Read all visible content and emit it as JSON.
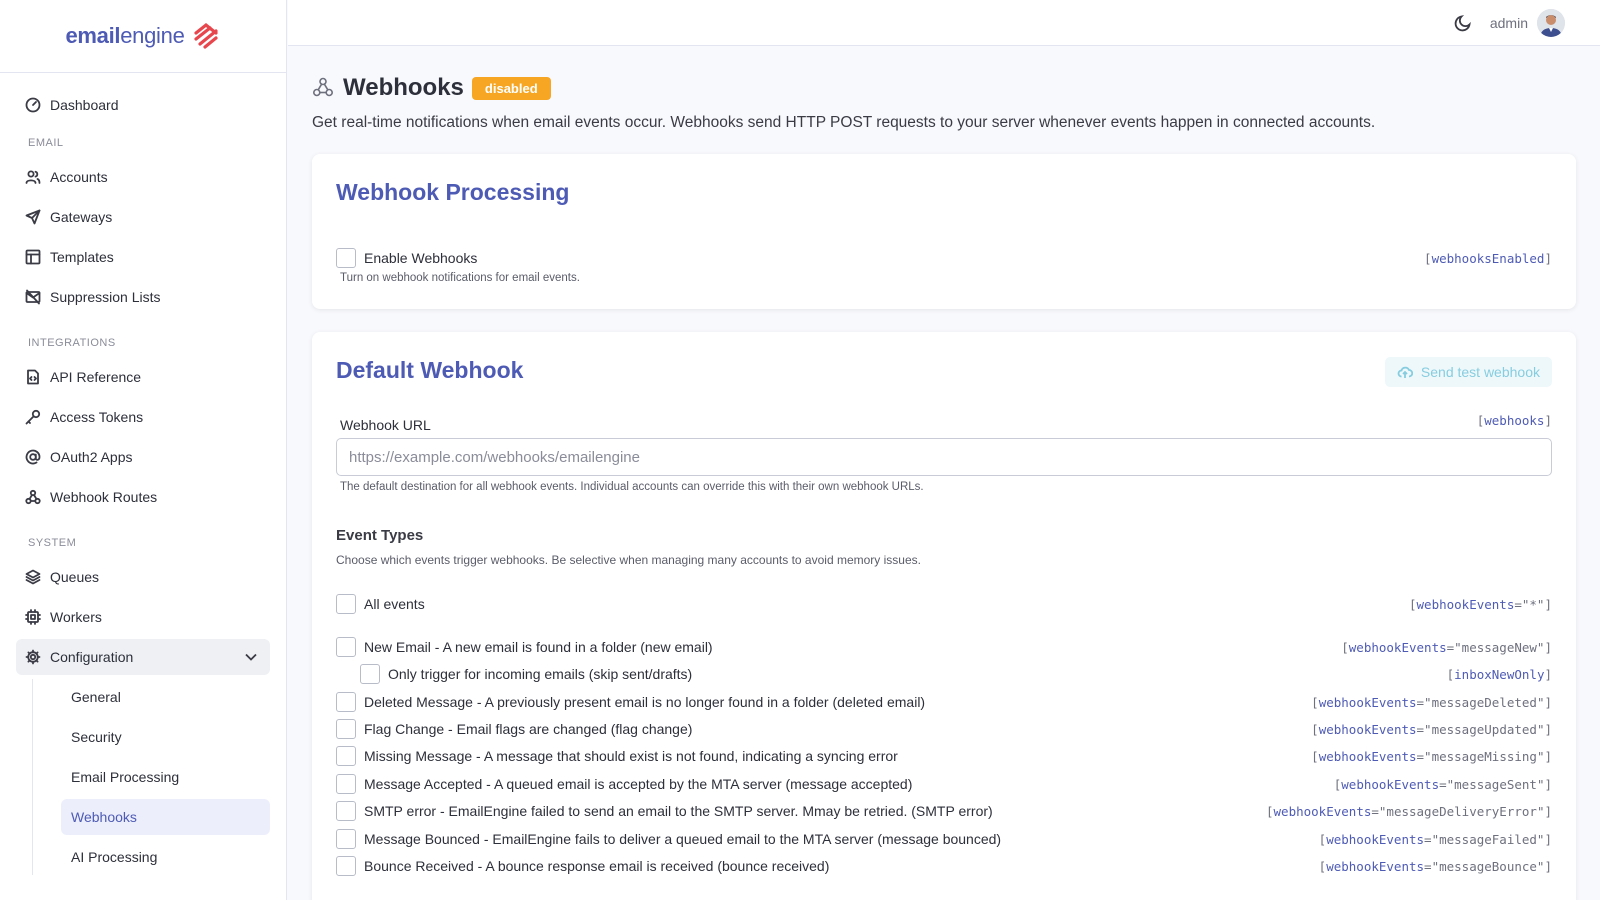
{
  "brand": {
    "name_bold": "email",
    "name_light": "engine",
    "logo_color": "#e8464d"
  },
  "sidebar": {
    "dashboard": "Dashboard",
    "email_heading": "EMAIL",
    "email_items": [
      "Accounts",
      "Gateways",
      "Templates",
      "Suppression Lists"
    ],
    "integrations_heading": "INTEGRATIONS",
    "integrations_items": [
      "API Reference",
      "Access Tokens",
      "OAuth2 Apps",
      "Webhook Routes"
    ],
    "system_heading": "SYSTEM",
    "system_items": [
      "Queues",
      "Workers",
      "Configuration"
    ],
    "config_sub": [
      "General",
      "Security",
      "Email Processing",
      "Webhooks",
      "AI Processing"
    ],
    "active_sub": "Webhooks"
  },
  "topbar": {
    "theme_icon": "moon-icon",
    "user_name": "admin"
  },
  "page": {
    "title": "Webhooks",
    "status_badge": "disabled",
    "description": "Get real-time notifications when email events occur. Webhooks send HTTP POST requests to your server whenever events happen in connected accounts."
  },
  "processing_card": {
    "title": "Webhook Processing",
    "enable_label": "Enable Webhooks",
    "enable_help": "Turn on webhook notifications for email events.",
    "enable_key": "webhooksEnabled"
  },
  "default_card": {
    "title": "Default Webhook",
    "test_button": "Send test webhook",
    "url_label": "Webhook URL",
    "url_key": "webhooks",
    "url_value": "",
    "url_placeholder": "https://example.com/webhooks/emailengine",
    "url_help": "The default destination for all webhook events. Individual accounts can override this with their own webhook URLs.",
    "events_title": "Event Types",
    "events_desc": "Choose which events trigger webhooks. Be selective when managing many accounts to avoid memory issues.",
    "events": [
      {
        "label": "All events",
        "key": "webhookEvents",
        "val": "=\"*\""
      },
      {
        "label": "New Email - A new email is found in a folder (new email)",
        "key": "webhookEvents",
        "val": "=\"messageNew\""
      },
      {
        "label": "Only trigger for incoming emails (skip sent/drafts)",
        "key": "inboxNewOnly",
        "val": ""
      },
      {
        "label": "Deleted Message - A previously present email is no longer found in a folder (deleted email)",
        "key": "webhookEvents",
        "val": "=\"messageDeleted\""
      },
      {
        "label": "Flag Change - Email flags are changed (flag change)",
        "key": "webhookEvents",
        "val": "=\"messageUpdated\""
      },
      {
        "label": "Missing Message - A message that should exist is not found, indicating a syncing error",
        "key": "webhookEvents",
        "val": "=\"messageMissing\""
      },
      {
        "label": "Message Accepted - A queued email is accepted by the MTA server (message accepted)",
        "key": "webhookEvents",
        "val": "=\"messageSent\""
      },
      {
        "label": "SMTP error - EmailEngine failed to send an email to the SMTP server. Mmay be retried. (SMTP error)",
        "key": "webhookEvents",
        "val": "=\"messageDeliveryError\""
      },
      {
        "label": "Message Bounced - EmailEngine fails to deliver a queued email to the MTA server (message bounced)",
        "key": "webhookEvents",
        "val": "=\"messageFailed\""
      },
      {
        "label": "Bounce Received - A bounce response email is received (bounce received)",
        "key": "webhookEvents",
        "val": "=\"messageBounce\""
      }
    ]
  }
}
